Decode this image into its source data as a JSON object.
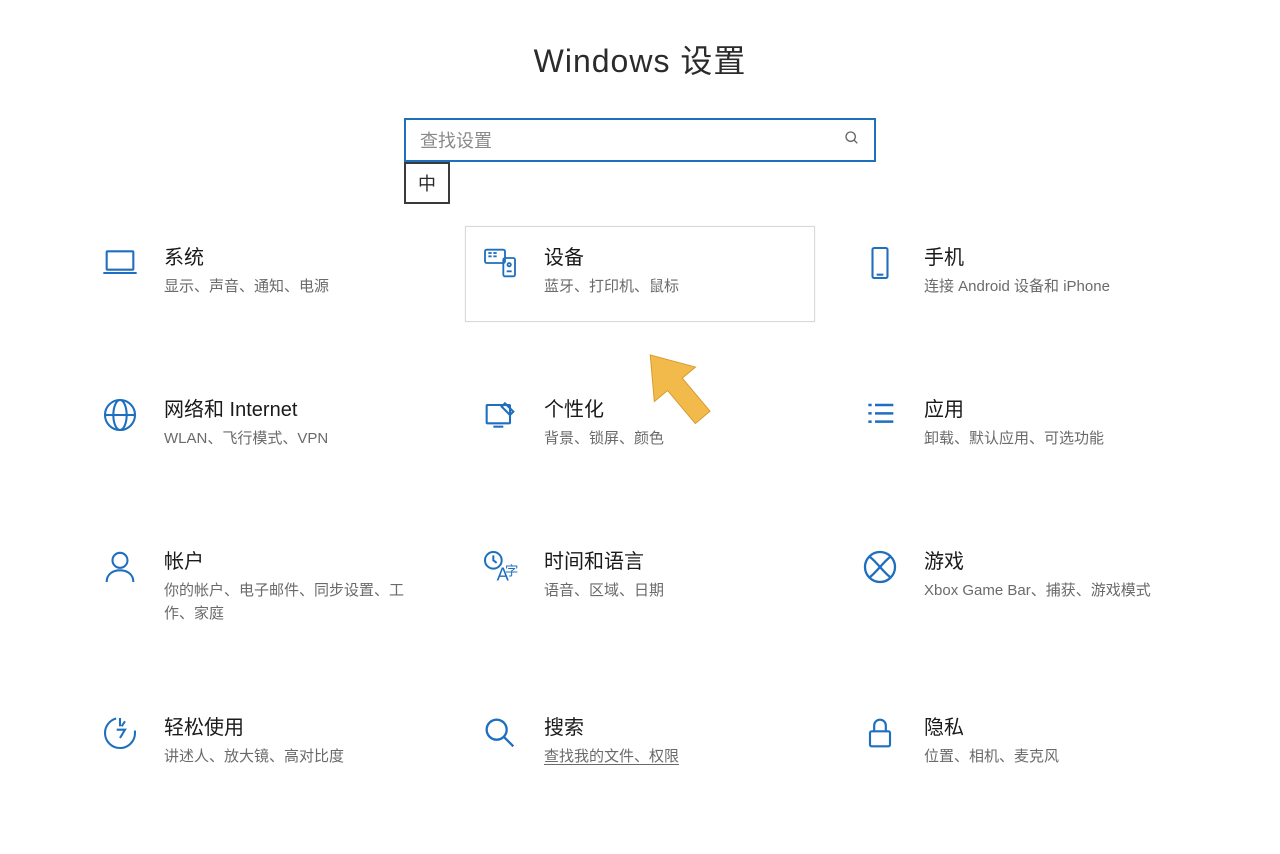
{
  "header": {
    "title": "Windows 设置"
  },
  "search": {
    "placeholder": "查找设置",
    "ime_badge": "中"
  },
  "tiles": [
    {
      "id": "system",
      "title": "系统",
      "desc": "显示、声音、通知、电源",
      "highlight": false
    },
    {
      "id": "devices",
      "title": "设备",
      "desc": "蓝牙、打印机、鼠标",
      "highlight": true
    },
    {
      "id": "phone",
      "title": "手机",
      "desc": "连接 Android 设备和 iPhone",
      "highlight": false
    },
    {
      "id": "network",
      "title": "网络和 Internet",
      "desc": "WLAN、飞行模式、VPN",
      "highlight": false
    },
    {
      "id": "personalize",
      "title": "个性化",
      "desc": "背景、锁屏、颜色",
      "highlight": false
    },
    {
      "id": "apps",
      "title": "应用",
      "desc": "卸载、默认应用、可选功能",
      "highlight": false
    },
    {
      "id": "accounts",
      "title": "帐户",
      "desc": "你的帐户、电子邮件、同步设置、工作、家庭",
      "highlight": false
    },
    {
      "id": "time",
      "title": "时间和语言",
      "desc": "语音、区域、日期",
      "highlight": false
    },
    {
      "id": "gaming",
      "title": "游戏",
      "desc": "Xbox Game Bar、捕获、游戏模式",
      "highlight": false
    },
    {
      "id": "ease",
      "title": "轻松使用",
      "desc": "讲述人、放大镜、高对比度",
      "highlight": false
    },
    {
      "id": "search",
      "title": "搜索",
      "desc": "查找我的文件、权限",
      "highlight": false,
      "desc_link": true
    },
    {
      "id": "privacy",
      "title": "隐私",
      "desc": "位置、相机、麦克风",
      "highlight": false
    }
  ],
  "colors": {
    "accent": "#1f6fbf",
    "arrow": "#f2b94b"
  }
}
